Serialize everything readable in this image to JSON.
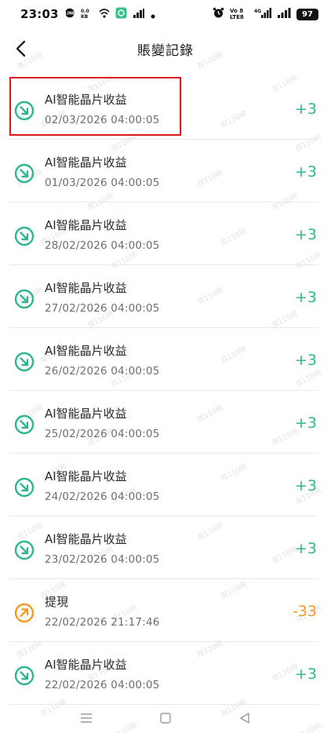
{
  "status_bar": {
    "time": "23:03",
    "volte_label": "Vo 8 LTE8",
    "network_label": "4G",
    "battery": "97"
  },
  "header": {
    "title": "賬變記錄"
  },
  "records": [
    {
      "title": "AI智能晶片收益",
      "time": "02/03/2026 04:00:05",
      "amount": "+3",
      "type": "income"
    },
    {
      "title": "AI智能晶片收益",
      "time": "01/03/2026 04:00:05",
      "amount": "+3",
      "type": "income"
    },
    {
      "title": "AI智能晶片收益",
      "time": "28/02/2026 04:00:05",
      "amount": "+3",
      "type": "income"
    },
    {
      "title": "AI智能晶片收益",
      "time": "27/02/2026 04:00:05",
      "amount": "+3",
      "type": "income"
    },
    {
      "title": "AI智能晶片收益",
      "time": "26/02/2026 04:00:05",
      "amount": "+3",
      "type": "income"
    },
    {
      "title": "AI智能晶片收益",
      "time": "25/02/2026 04:00:05",
      "amount": "+3",
      "type": "income"
    },
    {
      "title": "AI智能晶片收益",
      "time": "24/02/2026 04:00:05",
      "amount": "+3",
      "type": "income"
    },
    {
      "title": "AI智能晶片收益",
      "time": "23/02/2026 04:00:05",
      "amount": "+3",
      "type": "income"
    },
    {
      "title": "提現",
      "time": "22/02/2026 21:17:46",
      "amount": "-33",
      "type": "withdraw"
    },
    {
      "title": "AI智能晶片收益",
      "time": "22/02/2026 04:00:05",
      "amount": "+3",
      "type": "income"
    }
  ],
  "icons": {
    "income": "arrow-in-circle-icon",
    "withdraw": "arrow-out-circle-icon"
  },
  "colors": {
    "income": "#2fb58f",
    "withdraw": "#f39a28",
    "highlight": "#e0191b"
  },
  "watermark": "双110网"
}
